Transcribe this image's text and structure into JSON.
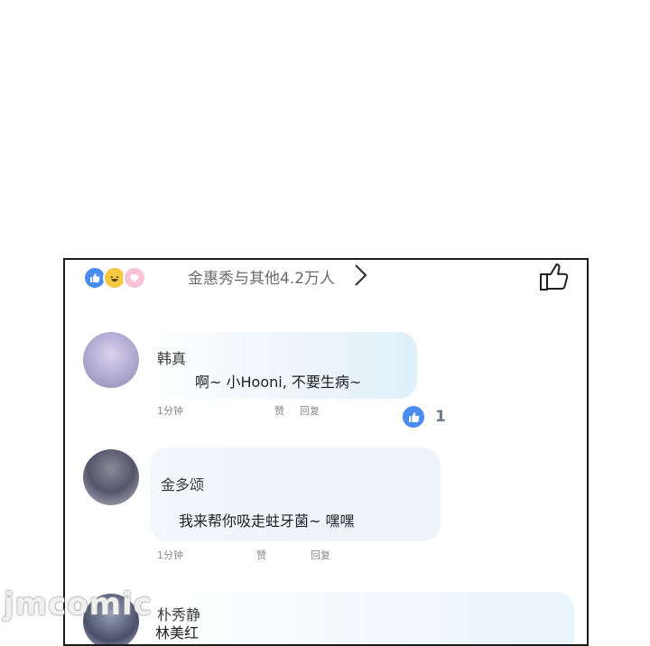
{
  "reactions": {
    "icons": [
      "like-icon",
      "haha-icon",
      "love-icon"
    ],
    "summary": "金惠秀与其他4.2万人"
  },
  "comments": [
    {
      "author": "韩真",
      "text": "啊~ 小Hooni, 不要生病~",
      "time": "1分钟",
      "like_label": "赞",
      "reply_label": "回复",
      "like_count": "1"
    },
    {
      "author": "金多颂",
      "text": "我来帮你吸走蛀牙菌~ 嘿嘿",
      "time": "1分钟",
      "like_label": "赞",
      "reply_label": "回复"
    },
    {
      "author": "朴秀静",
      "text": "林美红"
    }
  ],
  "watermark": "jmcomic",
  "colors": {
    "accent": "#4a8df0",
    "border": "#1a1a1a"
  }
}
